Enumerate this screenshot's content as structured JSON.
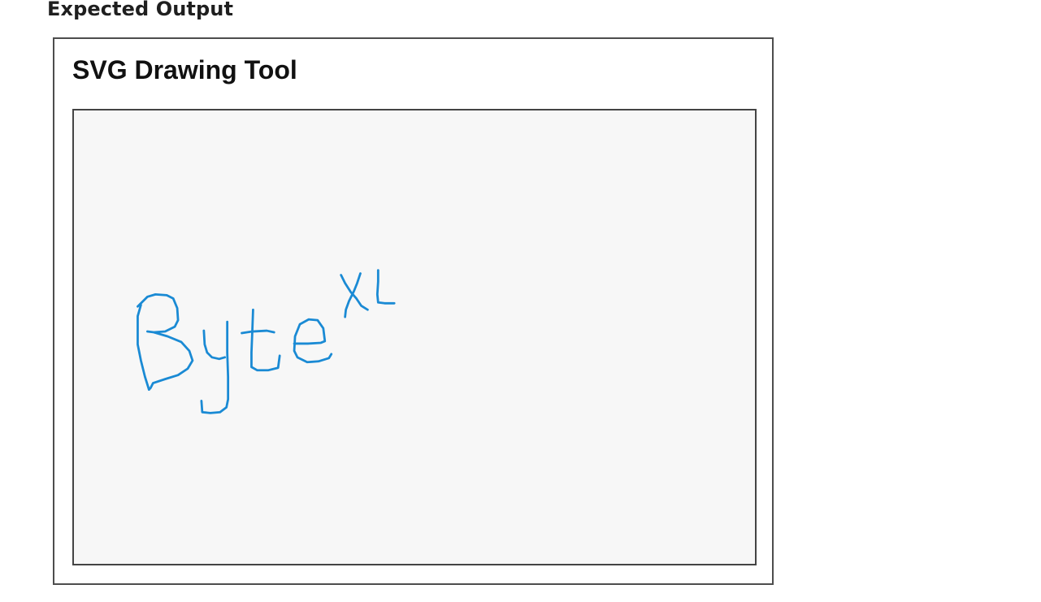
{
  "heading": "Expected Output",
  "app": {
    "title": "SVG Drawing Tool"
  },
  "canvas": {
    "background": "#f7f7f7",
    "stroke_color": "#1a8ad4",
    "handwritten_text": "ByteXL"
  }
}
